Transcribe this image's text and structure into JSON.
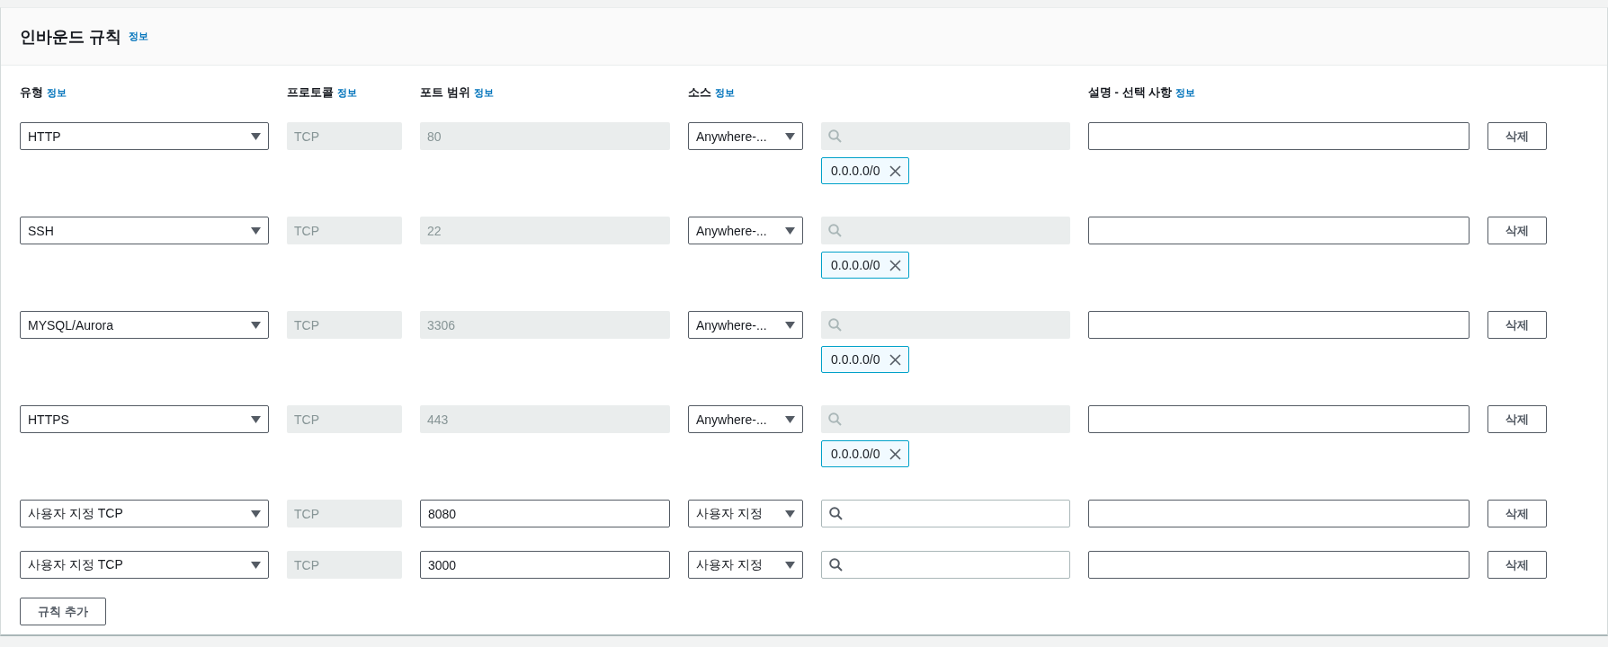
{
  "panel": {
    "title": "인바운드 규칙",
    "info": "정보"
  },
  "columns": [
    {
      "label": "유형",
      "info": "정보"
    },
    {
      "label": "프로토콜",
      "info": "정보"
    },
    {
      "label": "포트 범위",
      "info": "정보"
    },
    {
      "label": "소스",
      "info": "정보"
    },
    {
      "label": "설명 - 선택 사항",
      "info": "정보"
    }
  ],
  "rules": [
    {
      "type": "HTTP",
      "protocol": "TCP",
      "port": "80",
      "port_disabled": true,
      "source": "Anywhere-...",
      "search_disabled": true,
      "tags": [
        "0.0.0.0/0"
      ],
      "delete": "삭제"
    },
    {
      "type": "SSH",
      "protocol": "TCP",
      "port": "22",
      "port_disabled": true,
      "source": "Anywhere-...",
      "search_disabled": true,
      "tags": [
        "0.0.0.0/0"
      ],
      "delete": "삭제"
    },
    {
      "type": "MYSQL/Aurora",
      "protocol": "TCP",
      "port": "3306",
      "port_disabled": true,
      "source": "Anywhere-...",
      "search_disabled": true,
      "tags": [
        "0.0.0.0/0"
      ],
      "delete": "삭제"
    },
    {
      "type": "HTTPS",
      "protocol": "TCP",
      "port": "443",
      "port_disabled": true,
      "source": "Anywhere-...",
      "search_disabled": true,
      "tags": [
        "0.0.0.0/0"
      ],
      "delete": "삭제"
    },
    {
      "type": "사용자 지정 TCP",
      "protocol": "TCP",
      "port": "8080",
      "port_disabled": false,
      "source": "사용자 지정",
      "search_disabled": false,
      "delete": "삭제"
    },
    {
      "type": "사용자 지정 TCP",
      "protocol": "TCP",
      "port": "3000",
      "port_disabled": false,
      "source": "사용자 지정",
      "search_disabled": false,
      "delete": "삭제"
    }
  ],
  "add_button": "규칙 추가"
}
